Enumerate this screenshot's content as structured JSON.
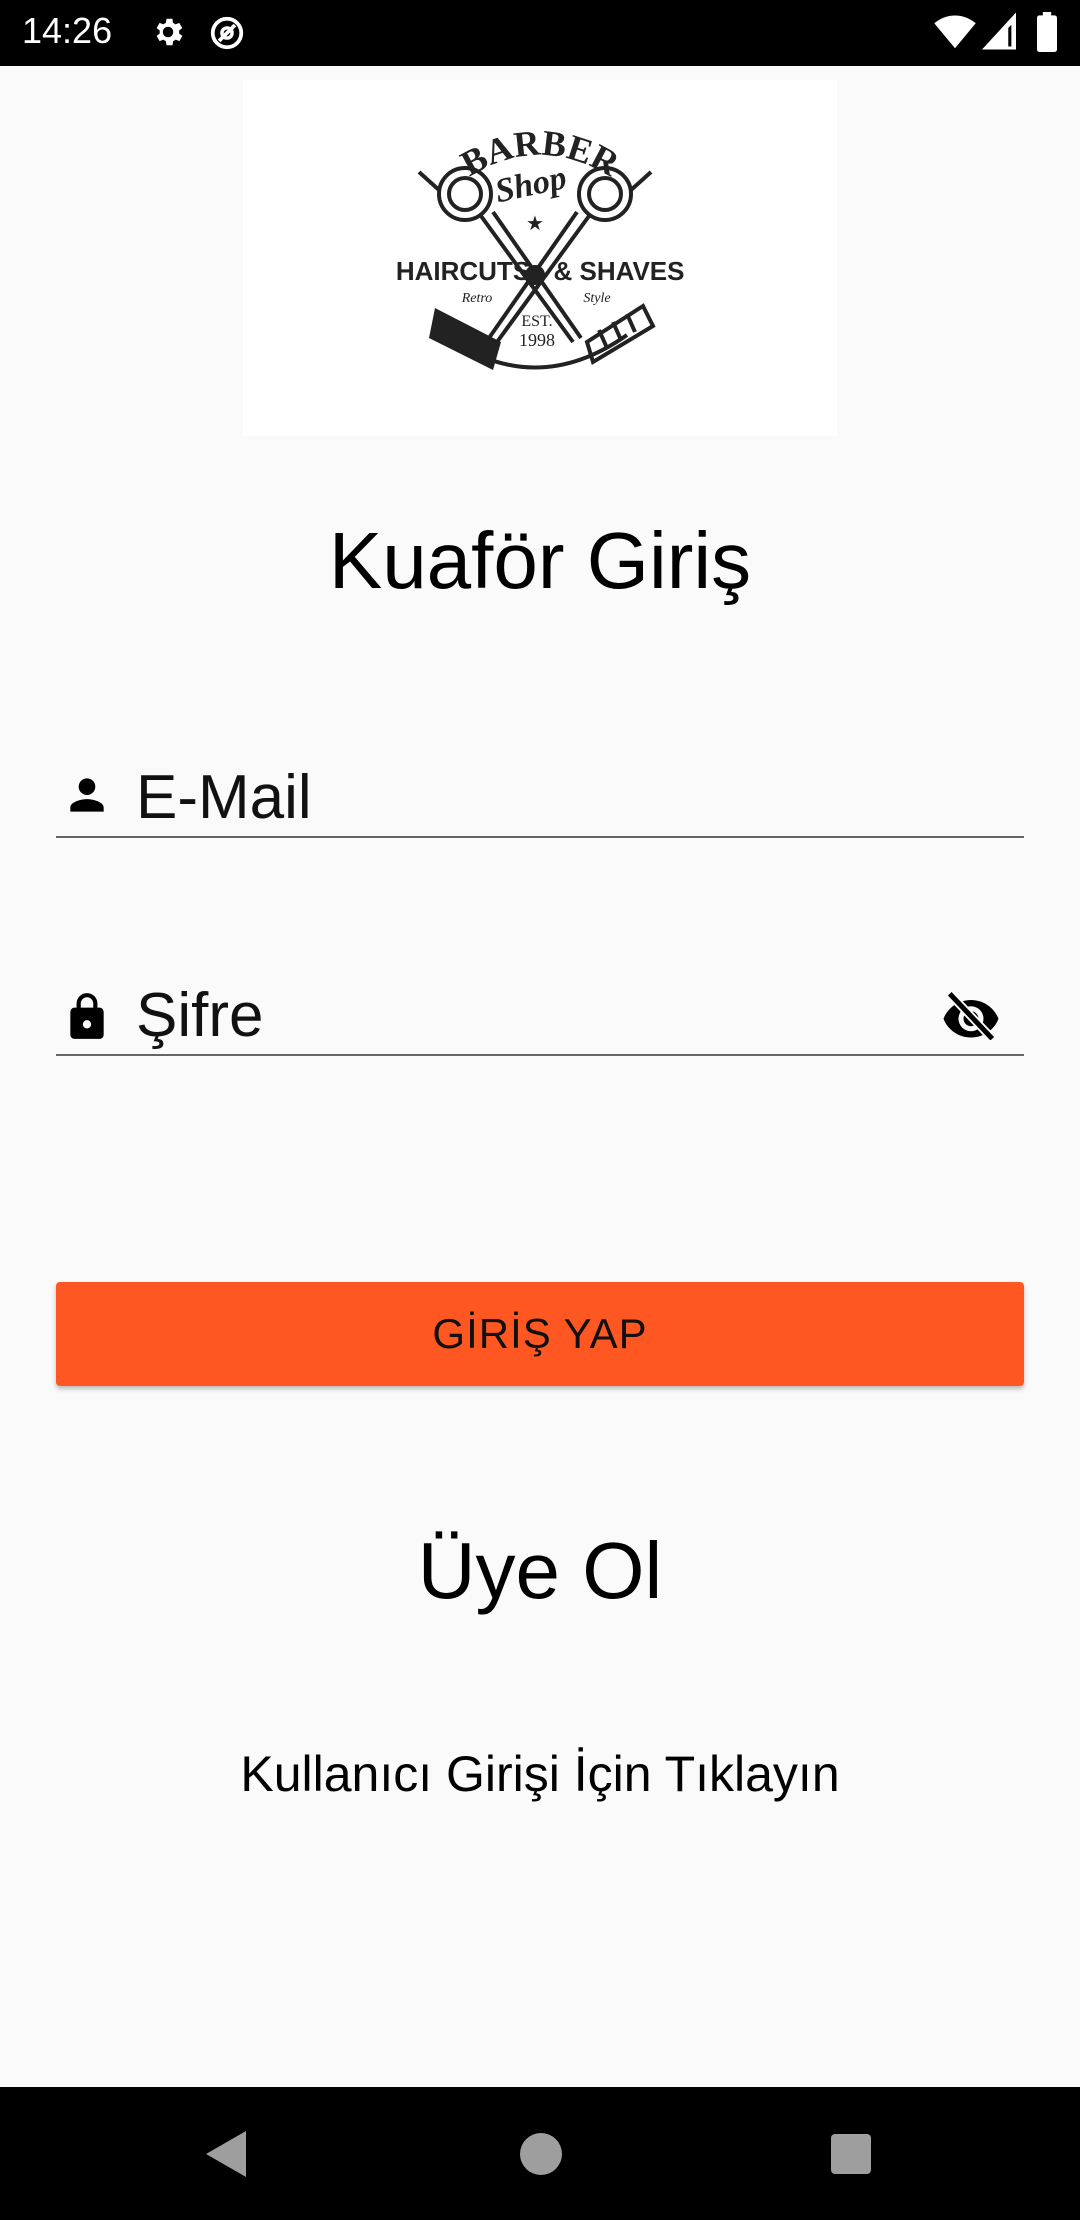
{
  "status_bar": {
    "time": "14:26",
    "icons": [
      "settings-icon",
      "at-sign-icon",
      "wifi-icon",
      "signal-icon",
      "battery-icon"
    ]
  },
  "logo": {
    "line1": "BARBER",
    "line2": "Shop",
    "left_text": "HAIRCUTS",
    "right_text": "& SHAVES",
    "small_left": "Retro",
    "small_right": "Style",
    "est": "EST.",
    "year": "1998"
  },
  "title": "Kuaför Giriş",
  "email_field": {
    "placeholder": "E-Mail",
    "value": "",
    "icon": "person-icon"
  },
  "password_field": {
    "placeholder": "Şifre",
    "value": "",
    "icon": "lock-icon",
    "toggle_icon": "eye-off-icon"
  },
  "login_button": {
    "label": "GİRİŞ YAP",
    "color": "#ff5722"
  },
  "register_link": "Üye Ol",
  "user_login_link": "Kullanıcı Girişi İçin Tıklayın",
  "nav_bar": {
    "icons": [
      "back-icon",
      "home-icon",
      "recents-icon"
    ]
  }
}
